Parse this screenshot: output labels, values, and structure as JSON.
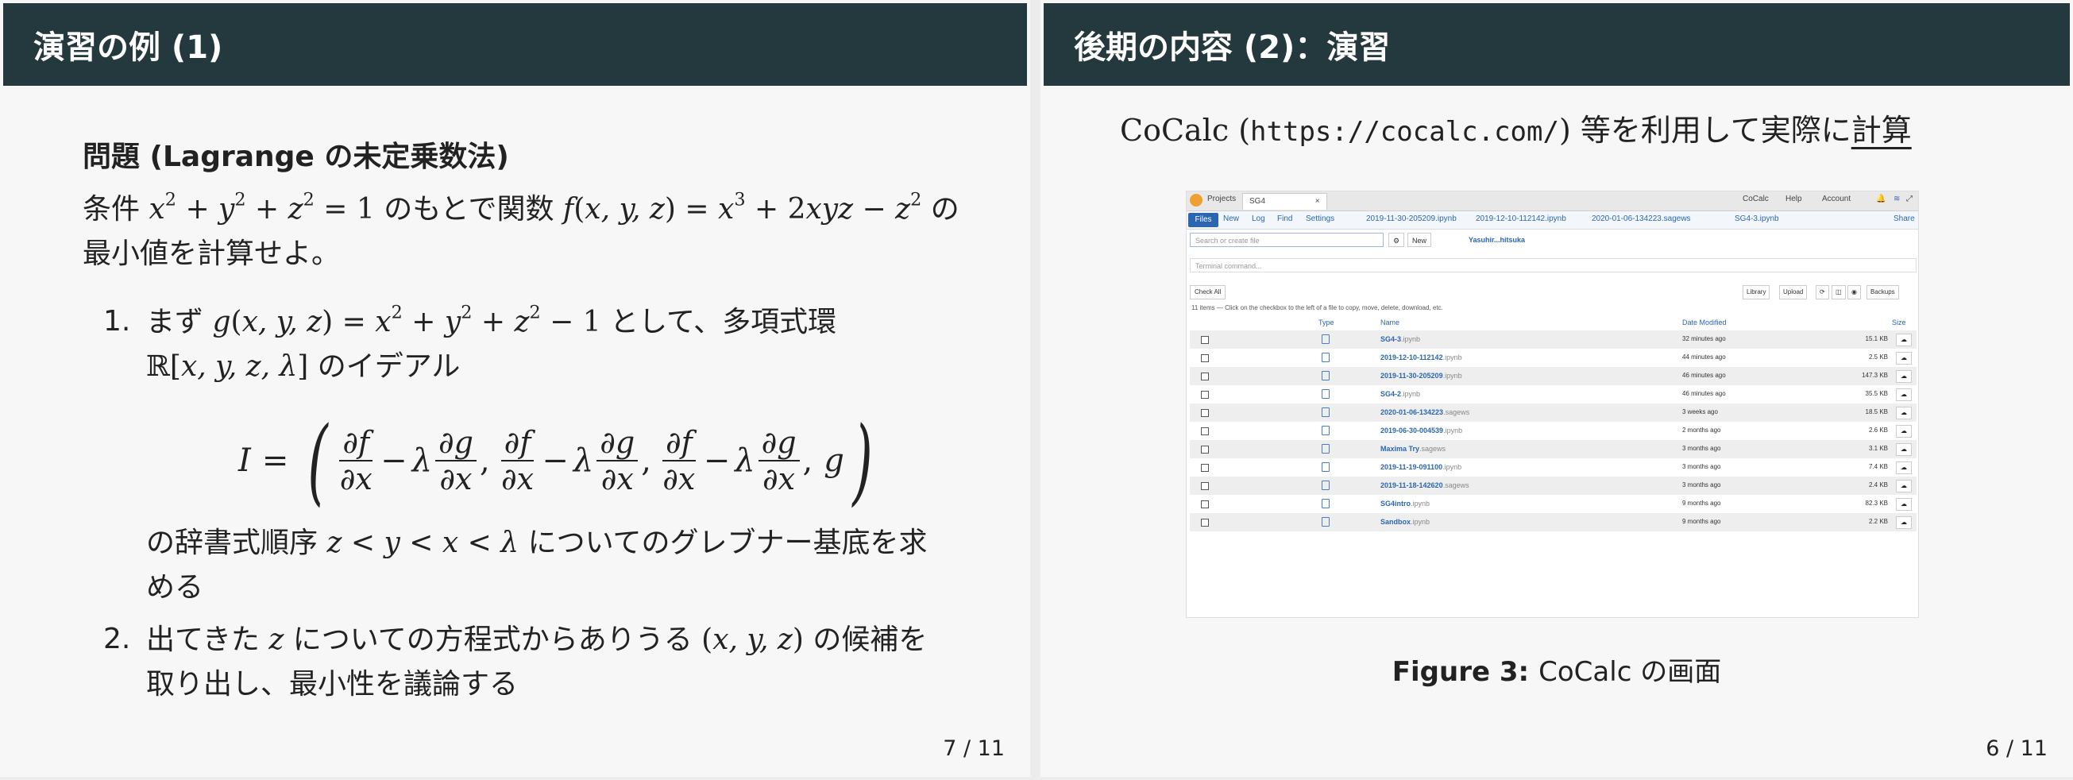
{
  "left_slide": {
    "title": "演習の例 (1)",
    "problem_title": "問題 (Lagrange の未定乗数法)",
    "intro_prefix": "条件",
    "intro_mid": "のもとで関数",
    "intro_suffix": "の",
    "intro_line2": "最小値を計算せよ。",
    "step1_num": "1.",
    "step1_prefix": "まず",
    "step1_suffix": "として、多項式環",
    "step1_line2": "のイデアル",
    "step1_after_line1": "の辞書式順序",
    "step1_after_suffix": "についてのグレブナー基底を求",
    "step1_after_line2": "める",
    "step2_num": "2.",
    "step2_prefix": "出てきた",
    "step2_mid": "についての方程式からありうる",
    "step2_suffix": "の候補を",
    "step2_line2": "取り出し、最小性を議論する",
    "page_number": "7 / 11"
  },
  "right_slide": {
    "title": "後期の内容 (2)：演習",
    "intro_prefix": "CoCalc (",
    "intro_url": "https://cocalc.com/",
    "intro_mid": ") 等を利用して実際に",
    "intro_underlined": "計算",
    "caption_label": "Figure 3:",
    "caption_text": "CoCalc の画面",
    "page_number": "6 / 11"
  },
  "cocalc": {
    "tabs": [
      "Projects",
      "SG4",
      "CoCalc",
      "Help",
      "Account"
    ],
    "toolbar": [
      "Files",
      "New",
      "Log",
      "Find",
      "Settings"
    ],
    "open_files": [
      "2019-11-30-205209.ipynb",
      "2019-12-10-112142.ipynb",
      "2020-01-06-134223.sagews",
      "SG4-3.ipynb"
    ],
    "share_label": "Share",
    "search_placeholder": "Search or create file",
    "new_label": "New",
    "path": "Yasuhir...hitsuka",
    "terminal_placeholder": "Terminal command...",
    "check_all": "Check All",
    "right_buttons": [
      "Library",
      "Upload",
      "Backups"
    ],
    "info": "11 items — Click on the checkbox to the left of a file to copy, move, delete, download, etc.",
    "columns": [
      "Type",
      "Name",
      "Date Modified",
      "Size"
    ],
    "files": [
      {
        "name": "SG4-3",
        "ext": ".ipynb",
        "date": "32 minutes ago",
        "size": "15.1 KB"
      },
      {
        "name": "2019-12-10-112142",
        "ext": ".ipynb",
        "date": "44 minutes ago",
        "size": "2.5 KB"
      },
      {
        "name": "2019-11-30-205209",
        "ext": ".ipynb",
        "date": "46 minutes ago",
        "size": "147.3 KB"
      },
      {
        "name": "SG4-2",
        "ext": ".ipynb",
        "date": "46 minutes ago",
        "size": "35.5 KB"
      },
      {
        "name": "2020-01-06-134223",
        "ext": ".sagews",
        "date": "3 weeks ago",
        "size": "18.5 KB"
      },
      {
        "name": "2019-06-30-004539",
        "ext": ".ipynb",
        "date": "2 months ago",
        "size": "2.6 KB"
      },
      {
        "name": "Maxima Try",
        "ext": ".sagews",
        "date": "3 months ago",
        "size": "3.1 KB"
      },
      {
        "name": "2019-11-19-091100",
        "ext": ".ipynb",
        "date": "3 months ago",
        "size": "7.4 KB"
      },
      {
        "name": "2019-11-18-142620",
        "ext": ".sagews",
        "date": "3 months ago",
        "size": "2.4 KB"
      },
      {
        "name": "SG4intro",
        "ext": ".ipynb",
        "date": "9 months ago",
        "size": "82.3 KB"
      },
      {
        "name": "Sandbox",
        "ext": ".ipynb",
        "date": "9 months ago",
        "size": "2.2 KB"
      }
    ]
  }
}
